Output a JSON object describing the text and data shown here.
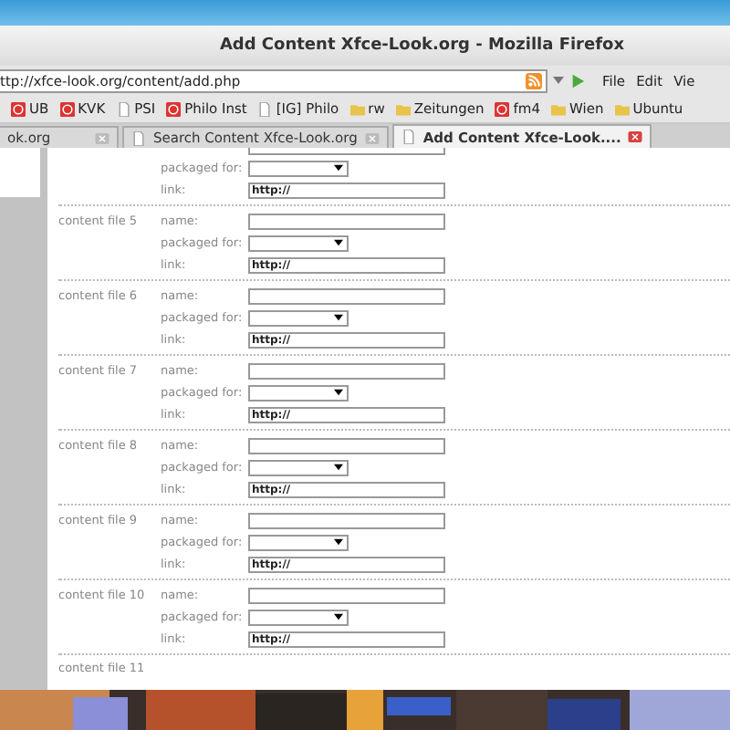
{
  "window": {
    "title": "Add Content Xfce-Look.org - Mozilla Firefox"
  },
  "url": "ttp://xfce-look.org/content/add.php",
  "menu": [
    "File",
    "Edit",
    "Vie"
  ],
  "bookmarks": [
    {
      "label": "UB",
      "kind": "site"
    },
    {
      "label": "KVK",
      "kind": "site"
    },
    {
      "label": "PSI",
      "kind": "page"
    },
    {
      "label": "Philo Inst",
      "kind": "site"
    },
    {
      "label": "[IG] Philo",
      "kind": "page"
    },
    {
      "label": "rw",
      "kind": "folder"
    },
    {
      "label": "Zeitungen",
      "kind": "folder"
    },
    {
      "label": "fm4",
      "kind": "site"
    },
    {
      "label": "Wien",
      "kind": "folder"
    },
    {
      "label": "Ubuntu",
      "kind": "folder"
    }
  ],
  "tabs": [
    {
      "label": "ok.org",
      "selected": false
    },
    {
      "label": "Search Content Xfce-Look.org",
      "selected": false
    },
    {
      "label": "Add Content Xfce-Look....",
      "selected": true
    }
  ],
  "form": {
    "files": [
      {
        "packaged_label": "packaged for:",
        "link_label": "link:",
        "link_value": "http://"
      },
      {
        "label": "content file 5",
        "name_label": "name:",
        "packaged_label": "packaged for:",
        "link_label": "link:",
        "link_value": "http://"
      },
      {
        "label": "content file 6",
        "name_label": "name:",
        "packaged_label": "packaged for:",
        "link_label": "link:",
        "link_value": "http://"
      },
      {
        "label": "content file 7",
        "name_label": "name:",
        "packaged_label": "packaged for:",
        "link_label": "link:",
        "link_value": "http://"
      },
      {
        "label": "content file 8",
        "name_label": "name:",
        "packaged_label": "packaged for:",
        "link_label": "link:",
        "link_value": "http://"
      },
      {
        "label": "content file 9",
        "name_label": "name:",
        "packaged_label": "packaged for:",
        "link_label": "link:",
        "link_value": "http://"
      },
      {
        "label": "content file 10",
        "name_label": "name:",
        "packaged_label": "packaged for:",
        "link_label": "link:",
        "link_value": "http://"
      }
    ],
    "next_label": "content file 11"
  }
}
